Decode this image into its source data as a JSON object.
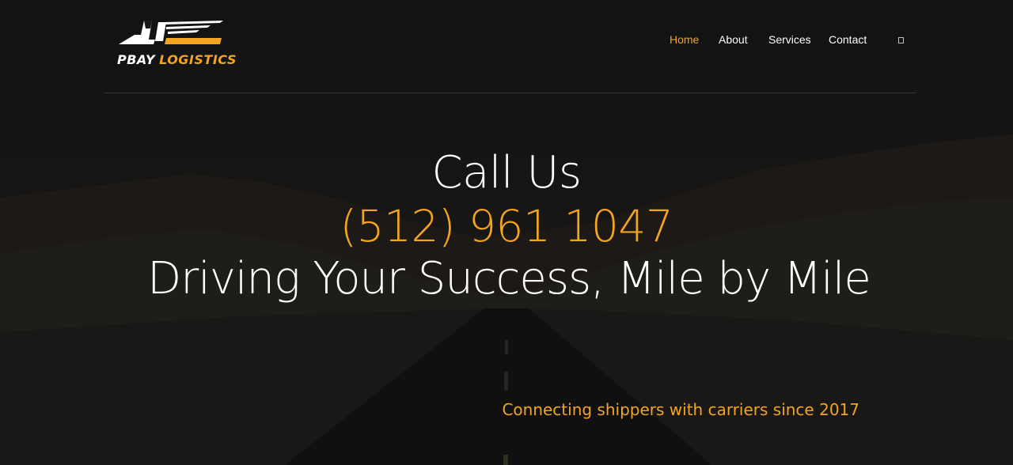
{
  "brand": {
    "logo_word": "PBAY",
    "logo_accent": "LOGISTICS",
    "accent_color": "#f3a421"
  },
  "nav": {
    "items": [
      {
        "label": "Home",
        "active": true
      },
      {
        "label": "About",
        "active": false
      },
      {
        "label": "Services",
        "active": false
      },
      {
        "label": "Contact",
        "active": false
      }
    ],
    "cart_icon": "cart-icon"
  },
  "hero": {
    "heading": "Call Us",
    "phone": "(512) 961 1047",
    "tagline": "Driving Your Success, Mile by Mile",
    "subtitle": "Connecting shippers with carriers since 2017"
  }
}
